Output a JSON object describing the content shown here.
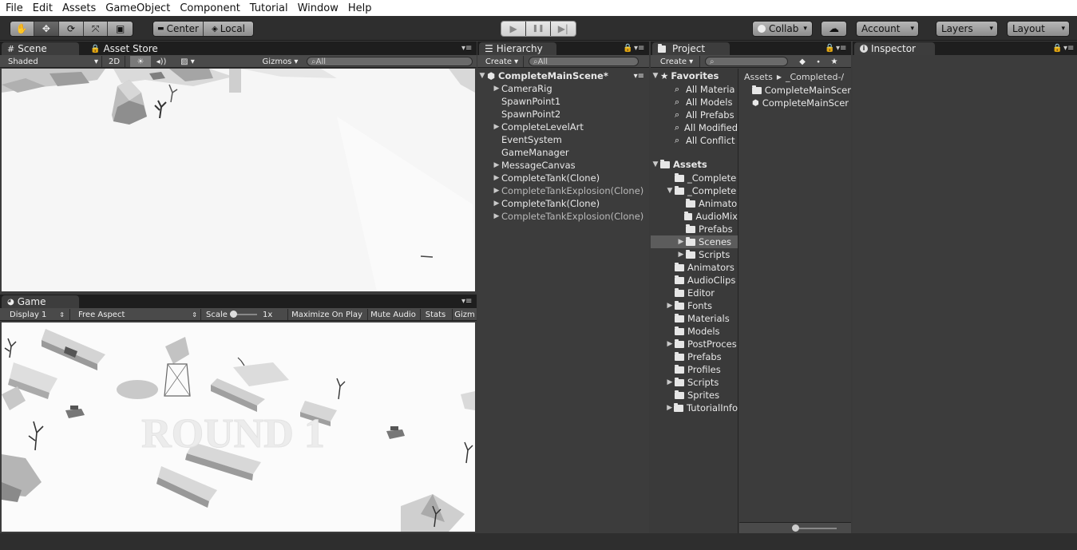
{
  "menu": [
    "File",
    "Edit",
    "Assets",
    "GameObject",
    "Component",
    "Tutorial",
    "Window",
    "Help"
  ],
  "toolbar": {
    "center_label": "Center",
    "local_label": "Local",
    "collab_label": "Collab",
    "account_label": "Account",
    "layers_label": "Layers",
    "layout_label": "Layout",
    "tools": [
      "hand-icon",
      "move-icon",
      "rotate-icon",
      "scale-icon",
      "rect-icon"
    ],
    "dropdown_glyph": "▾"
  },
  "scene": {
    "tab_label": "Scene",
    "asset_store_label": "Asset Store",
    "shading": "Shaded",
    "mode_2d": "2D",
    "gizmos_label": "Gizmos",
    "search_placeholder": "All"
  },
  "game": {
    "tab_label": "Game",
    "display": "Display 1",
    "aspect": "Free Aspect",
    "scale_label": "Scale",
    "scale_value": "1x",
    "maximize_label": "Maximize On Play",
    "mute_label": "Mute Audio",
    "stats_label": "Stats",
    "gizmos_label": "Gizm",
    "overlay_text": "ROUND 1"
  },
  "hierarchy": {
    "tab_label": "Hierarchy",
    "create_label": "Create",
    "search_placeholder": "All",
    "scene_name": "CompleteMainScene*",
    "items": [
      {
        "label": "CameraRig",
        "expandable": true,
        "dim": false
      },
      {
        "label": "SpawnPoint1",
        "expandable": false,
        "dim": false
      },
      {
        "label": "SpawnPoint2",
        "expandable": false,
        "dim": false
      },
      {
        "label": "CompleteLevelArt",
        "expandable": true,
        "dim": false
      },
      {
        "label": "EventSystem",
        "expandable": false,
        "dim": false
      },
      {
        "label": "GameManager",
        "expandable": false,
        "dim": false
      },
      {
        "label": "MessageCanvas",
        "expandable": true,
        "dim": false
      },
      {
        "label": "CompleteTank(Clone)",
        "expandable": true,
        "dim": false
      },
      {
        "label": "CompleteTankExplosion(Clone)",
        "expandable": true,
        "dim": true
      },
      {
        "label": "CompleteTank(Clone)",
        "expandable": true,
        "dim": false
      },
      {
        "label": "CompleteTankExplosion(Clone)",
        "expandable": true,
        "dim": true
      }
    ]
  },
  "project": {
    "tab_label": "Project",
    "create_label": "Create",
    "favorites_label": "Favorites",
    "favorites": [
      "All Materia",
      "All Models",
      "All Prefabs",
      "All Modified",
      "All Conflict"
    ],
    "assets_label": "Assets",
    "tree": [
      {
        "label": "_Complete",
        "indent": 1,
        "arrow": "",
        "selected": false
      },
      {
        "label": "_Complete",
        "indent": 1,
        "arrow": "▼",
        "selected": false
      },
      {
        "label": "Animato",
        "indent": 2,
        "arrow": "",
        "selected": false
      },
      {
        "label": "AudioMix",
        "indent": 2,
        "arrow": "",
        "selected": false
      },
      {
        "label": "Prefabs",
        "indent": 2,
        "arrow": "",
        "selected": false
      },
      {
        "label": "Scenes",
        "indent": 2,
        "arrow": "▶",
        "selected": true
      },
      {
        "label": "Scripts",
        "indent": 2,
        "arrow": "▶",
        "selected": false
      },
      {
        "label": "Animators",
        "indent": 1,
        "arrow": "",
        "selected": false
      },
      {
        "label": "AudioClips",
        "indent": 1,
        "arrow": "",
        "selected": false
      },
      {
        "label": "Editor",
        "indent": 1,
        "arrow": "",
        "selected": false
      },
      {
        "label": "Fonts",
        "indent": 1,
        "arrow": "▶",
        "selected": false
      },
      {
        "label": "Materials",
        "indent": 1,
        "arrow": "",
        "selected": false
      },
      {
        "label": "Models",
        "indent": 1,
        "arrow": "",
        "selected": false
      },
      {
        "label": "PostProces",
        "indent": 1,
        "arrow": "▶",
        "selected": false
      },
      {
        "label": "Prefabs",
        "indent": 1,
        "arrow": "",
        "selected": false
      },
      {
        "label": "Profiles",
        "indent": 1,
        "arrow": "",
        "selected": false
      },
      {
        "label": "Scripts",
        "indent": 1,
        "arrow": "▶",
        "selected": false
      },
      {
        "label": "Sprites",
        "indent": 1,
        "arrow": "",
        "selected": false
      },
      {
        "label": "TutorialInfo",
        "indent": 1,
        "arrow": "▶",
        "selected": false
      }
    ],
    "breadcrumb": [
      "Assets",
      "_Completed-/"
    ],
    "files": [
      {
        "label": "CompleteMainScer",
        "icon": "folder-icon"
      },
      {
        "label": "CompleteMainScer",
        "icon": "unity-scene-icon"
      }
    ]
  },
  "inspector": {
    "tab_label": "Inspector"
  }
}
